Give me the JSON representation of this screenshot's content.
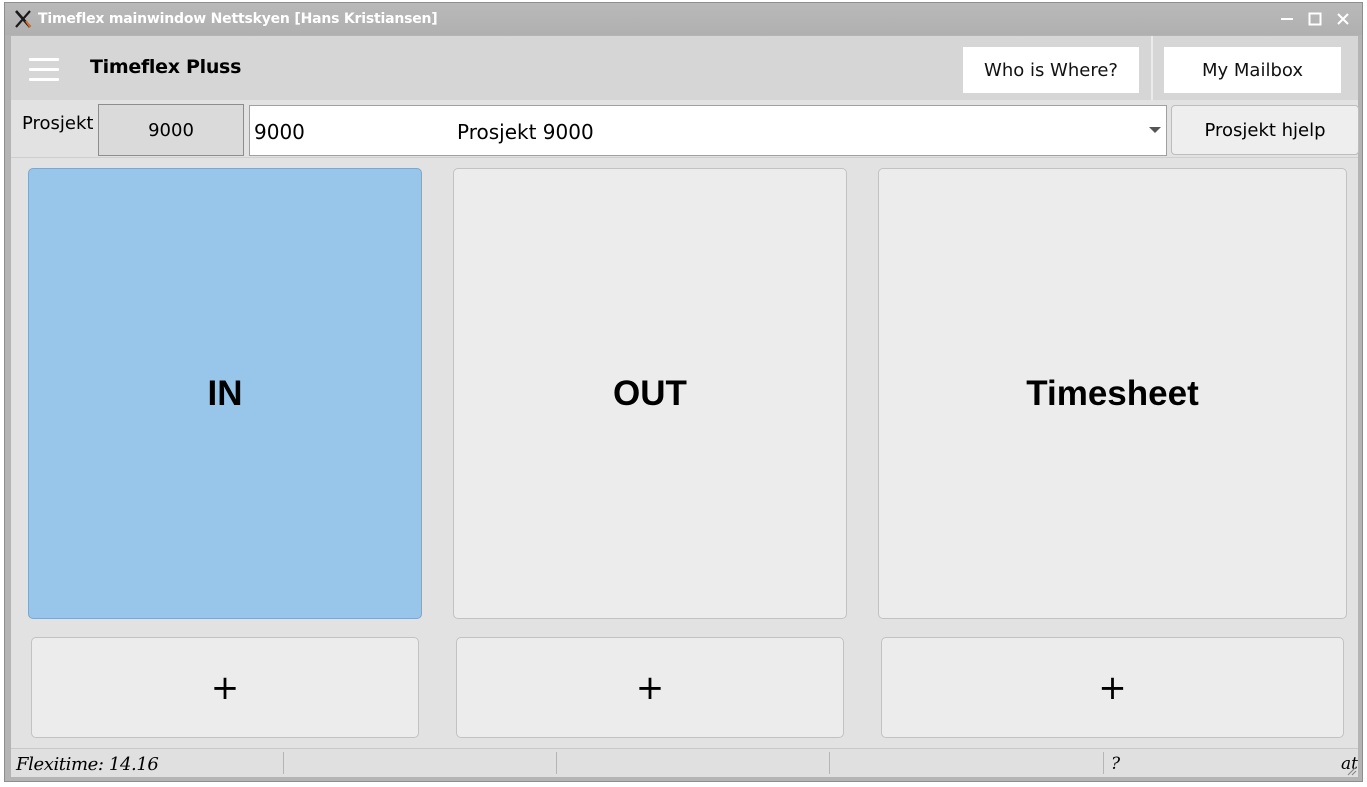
{
  "window": {
    "title": "Timeflex mainwindow Nettskyen [Hans Kristiansen]"
  },
  "header": {
    "app_name": "Timeflex Pluss",
    "who_is_where_label": "Who is Where?",
    "mailbox_label": "My Mailbox"
  },
  "project": {
    "label": "Prosjekt",
    "code": "9000",
    "selected_number": "9000",
    "selected_name": "Prosjekt 9000",
    "help_label": "Prosjekt hjelp"
  },
  "actions": {
    "in_label": "IN",
    "out_label": "OUT",
    "timesheet_label": "Timesheet",
    "plus_in_label": "+",
    "plus_out_label": "+",
    "plus_timesheet_label": "+"
  },
  "statusbar": {
    "flexitime": "Flexitime: 14.16",
    "help_marker": "?",
    "at_marker": "at"
  },
  "colors": {
    "in_button": "#98c5ea",
    "button_gray": "#ececec",
    "titlebar": "#b4b4b4"
  }
}
